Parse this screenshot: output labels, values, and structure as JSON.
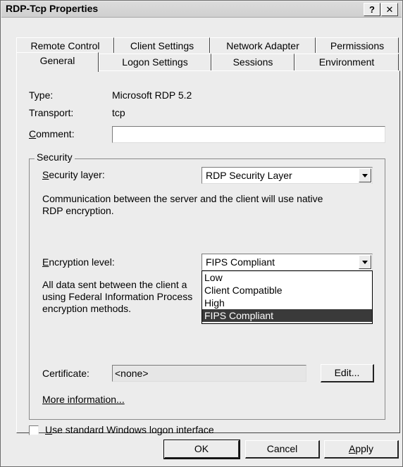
{
  "window": {
    "title": "RDP-Tcp Properties",
    "help_label": "?",
    "close_label": "✕"
  },
  "tabs": {
    "back_row": [
      "Remote Control",
      "Client Settings",
      "Network Adapter",
      "Permissions"
    ],
    "front_row": [
      "General",
      "Logon Settings",
      "Sessions",
      "Environment"
    ],
    "active": "General"
  },
  "general": {
    "type_label": "Type:",
    "type_value": "Microsoft RDP 5.2",
    "transport_label": "Transport:",
    "transport_value": "tcp",
    "comment_label_u": "C",
    "comment_label_rest": "omment:",
    "comment_value": ""
  },
  "security": {
    "group_label": "Security",
    "layer_label_u": "S",
    "layer_label_rest": "ecurity layer:",
    "layer_value": "RDP Security Layer",
    "layer_description_line1": "Communication between the server and the client will use native",
    "layer_description_line2": "RDP encryption.",
    "encryption_label_u": "E",
    "encryption_label_rest": "ncryption level:",
    "encryption_value": "FIPS Compliant",
    "encryption_options": [
      "Low",
      "Client Compatible",
      "High",
      "FIPS Compliant"
    ],
    "encryption_selected_index": 3,
    "encryption_description_line1": "All data sent between the client a",
    "encryption_description_line2": "using Federal Information Process",
    "encryption_description_line3": "encryption methods.",
    "certificate_label": "Certificate:",
    "certificate_value": "<none>",
    "edit_button": "Edit...",
    "more_info_link": "More information..."
  },
  "logon": {
    "checkbox_label_u": "U",
    "checkbox_label_rest": "se standard Windows logon interface",
    "checked": false
  },
  "footer": {
    "ok": "OK",
    "cancel": "Cancel",
    "apply_u": "A",
    "apply_rest": "pply"
  }
}
